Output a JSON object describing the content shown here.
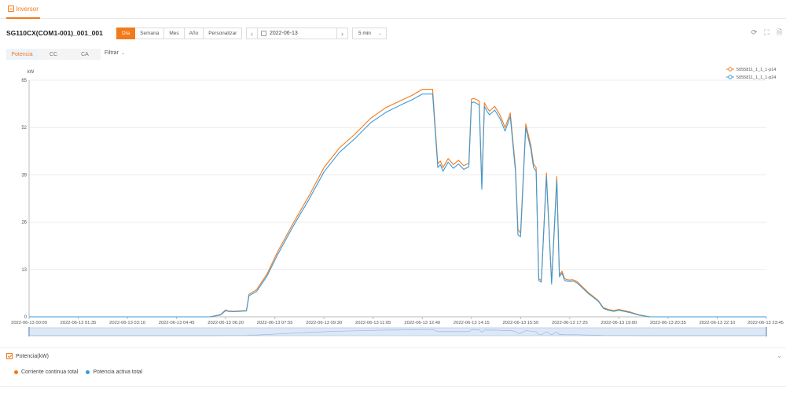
{
  "tab": {
    "label": "Inversor"
  },
  "device": {
    "title": "SG110CX(COM1-001)_001_001"
  },
  "period": {
    "options": [
      "Día",
      "Semana",
      "Mes",
      "Año",
      "Personalizar"
    ],
    "active_index": 0
  },
  "date": {
    "value": "2022-06-13"
  },
  "interval": {
    "value": "5 min"
  },
  "subtabs": {
    "items": [
      "Potencia",
      "CC",
      "CA"
    ],
    "active_index": 0
  },
  "filter": {
    "label": "Filtrar"
  },
  "icons": {
    "refresh": "refresh-icon",
    "fullscreen": "fullscreen-icon",
    "export": "export-icon"
  },
  "colors": {
    "accent": "#f27a1a",
    "series1": "#f27a1a",
    "series2": "#3b9ad9"
  },
  "panel": {
    "title": "Potencia(kW)",
    "legend": [
      {
        "label": "Corriente continua total",
        "color": "#f27a1a"
      },
      {
        "label": "Potencia activa total",
        "color": "#3b9ad9"
      }
    ]
  },
  "chart_data": {
    "type": "line",
    "ylabel": "kW",
    "ylim": [
      0,
      65
    ],
    "yticks": [
      0,
      13,
      26,
      39,
      52,
      65
    ],
    "xlim_hours": [
      0,
      23.75
    ],
    "xtick_labels": [
      "2022-06-13 00:00",
      "2022-06-13 01:35",
      "2022-06-13 03:10",
      "2022-06-13 04:45",
      "2022-06-13 06:20",
      "2022-06-13 07:55",
      "2022-06-13 09:30",
      "2022-06-13 11:05",
      "2022-06-13 12:40",
      "2022-06-13 14:15",
      "2022-06-13 15:50",
      "2022-06-13 17:25",
      "2022-06-13 19:00",
      "2022-06-13 20:35",
      "2022-06-13 22:10",
      "2022-06-13 23:45"
    ],
    "legend_position": "top-right",
    "grid": true,
    "series": [
      {
        "name": "5055811_1_1_1-p14",
        "x": [
          "00:00",
          "05:50",
          "06:10",
          "06:20",
          "06:25",
          "06:35",
          "06:45",
          "07:00",
          "07:05",
          "07:20",
          "07:40",
          "08:00",
          "08:30",
          "09:00",
          "09:30",
          "10:00",
          "10:30",
          "11:00",
          "11:30",
          "12:00",
          "12:20",
          "12:40",
          "13:00",
          "13:10",
          "13:15",
          "13:20",
          "13:30",
          "13:40",
          "13:50",
          "14:00",
          "14:10",
          "14:15",
          "14:20",
          "14:30",
          "14:35",
          "14:40",
          "14:45",
          "14:50",
          "15:00",
          "15:10",
          "15:20",
          "15:30",
          "15:40",
          "15:45",
          "15:50",
          "16:00",
          "16:10",
          "16:15",
          "16:20",
          "16:25",
          "16:30",
          "16:40",
          "16:50",
          "17:00",
          "17:05",
          "17:10",
          "17:15",
          "17:20",
          "17:25",
          "17:30",
          "17:35",
          "17:40",
          "18:00",
          "18:20",
          "18:30",
          "18:40",
          "18:50",
          "19:00",
          "19:20",
          "19:40",
          "20:00",
          "20:10",
          "20:20",
          "20:35",
          "20:45",
          "23:45"
        ],
        "y": [
          0,
          0,
          0.6,
          1.9,
          1.6,
          1.5,
          1.6,
          1.7,
          6.2,
          7.5,
          11.8,
          17.8,
          25.6,
          33.0,
          41.0,
          46.4,
          50.2,
          54.5,
          57.5,
          59.5,
          60.8,
          62.5,
          62.5,
          42.0,
          42.8,
          41.0,
          43.5,
          41.8,
          43.0,
          41.5,
          42.2,
          59.8,
          60.0,
          59.3,
          36.0,
          58.8,
          57.5,
          56.5,
          57.8,
          55.5,
          52.0,
          56.0,
          41.0,
          24.0,
          23.0,
          53.0,
          47.0,
          42.0,
          41.0,
          10.5,
          10.0,
          39.5,
          9.5,
          38.5,
          11.5,
          12.5,
          10.5,
          10.2,
          10.1,
          10.2,
          10.0,
          9.6,
          6.8,
          4.5,
          2.5,
          2.0,
          1.7,
          2.0,
          1.4,
          0.5,
          0,
          0,
          0,
          0,
          0,
          0
        ]
      },
      {
        "name": "5055811_1_1_1-p24",
        "x": [
          "00:00",
          "05:50",
          "06:10",
          "06:20",
          "06:25",
          "06:35",
          "06:45",
          "07:00",
          "07:05",
          "07:20",
          "07:40",
          "08:00",
          "08:30",
          "09:00",
          "09:30",
          "10:00",
          "10:30",
          "11:00",
          "11:30",
          "12:00",
          "12:20",
          "12:40",
          "13:00",
          "13:10",
          "13:15",
          "13:20",
          "13:30",
          "13:40",
          "13:50",
          "14:00",
          "14:10",
          "14:15",
          "14:20",
          "14:30",
          "14:35",
          "14:40",
          "14:45",
          "14:50",
          "15:00",
          "15:10",
          "15:20",
          "15:30",
          "15:40",
          "15:45",
          "15:50",
          "16:00",
          "16:10",
          "16:15",
          "16:20",
          "16:25",
          "16:30",
          "16:40",
          "16:50",
          "17:00",
          "17:05",
          "17:10",
          "17:15",
          "17:20",
          "17:25",
          "17:30",
          "17:35",
          "17:40",
          "18:00",
          "18:20",
          "18:30",
          "18:40",
          "18:50",
          "19:00",
          "19:20",
          "19:40",
          "20:00",
          "20:10",
          "20:20",
          "20:35",
          "20:45",
          "23:45"
        ],
        "y": [
          0,
          0,
          0.5,
          1.7,
          1.5,
          1.4,
          1.5,
          1.6,
          5.8,
          7.0,
          11.2,
          17.0,
          24.8,
          32.0,
          39.8,
          45.2,
          49.0,
          53.3,
          56.2,
          58.3,
          59.6,
          61.2,
          61.2,
          41.0,
          41.8,
          40.0,
          42.5,
          40.8,
          42.0,
          40.5,
          41.2,
          58.8,
          59.0,
          58.2,
          35.0,
          57.8,
          56.5,
          55.5,
          56.8,
          54.5,
          51.0,
          55.0,
          40.0,
          22.5,
          22.0,
          52.0,
          46.0,
          41.0,
          40.0,
          10.0,
          9.5,
          38.5,
          9.0,
          37.5,
          11.0,
          12.0,
          10.0,
          9.8,
          9.7,
          9.8,
          9.6,
          9.2,
          6.5,
          4.3,
          2.3,
          1.8,
          1.5,
          1.8,
          1.2,
          0.4,
          0,
          0,
          0,
          0,
          0,
          0
        ]
      }
    ]
  }
}
